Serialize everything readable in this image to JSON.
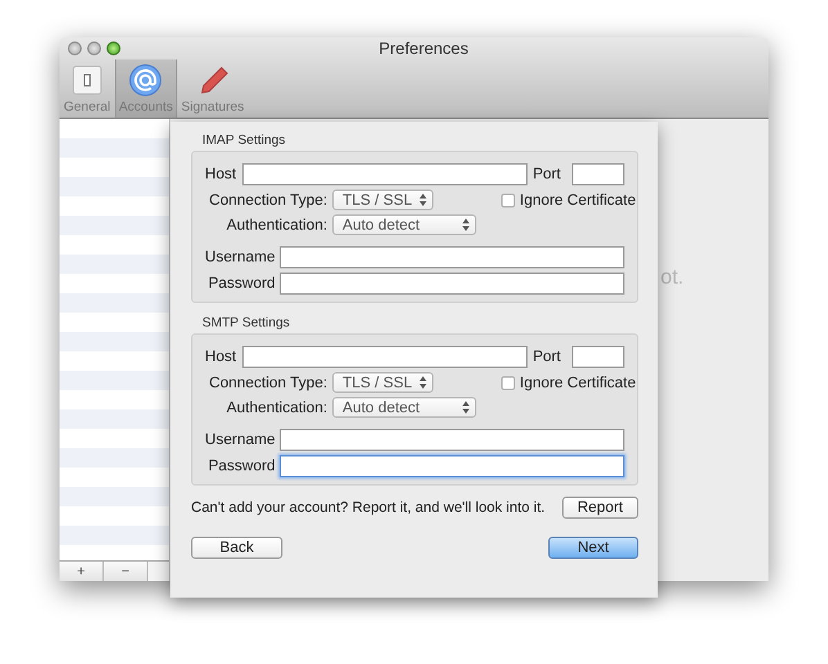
{
  "window": {
    "title": "Preferences"
  },
  "toolbar": [
    {
      "label": "General",
      "kind": "general",
      "selected": false
    },
    {
      "label": "Accounts",
      "kind": "accounts",
      "selected": true
    },
    {
      "label": "Signatures",
      "kind": "signatures",
      "selected": false
    }
  ],
  "sidebar": {
    "buttons": [
      "+",
      "−"
    ]
  },
  "background_text": "ot.",
  "sheet": {
    "sections": [
      {
        "title": "IMAP Settings",
        "host": "Host",
        "port": "Port",
        "connection_label": "Connection Type:",
        "connection_value": "TLS / SSL",
        "ignore_label": "Ignore Certificate",
        "ignore_checked": false,
        "auth_label": "Authentication:",
        "auth_value": "Auto detect",
        "username": "Username",
        "password": "Password",
        "password_focused": false
      },
      {
        "title": "SMTP Settings",
        "host": "Host",
        "port": "Port",
        "connection_label": "Connection Type:",
        "connection_value": "TLS / SSL",
        "ignore_label": "Ignore Certificate",
        "ignore_checked": false,
        "auth_label": "Authentication:",
        "auth_value": "Auto detect",
        "username": "Username",
        "password": "Password",
        "password_focused": true
      }
    ],
    "report_text": "Can't add your account? Report it, and we'll look into it.",
    "report_button": "Report",
    "back_button": "Back",
    "next_button": "Next"
  }
}
